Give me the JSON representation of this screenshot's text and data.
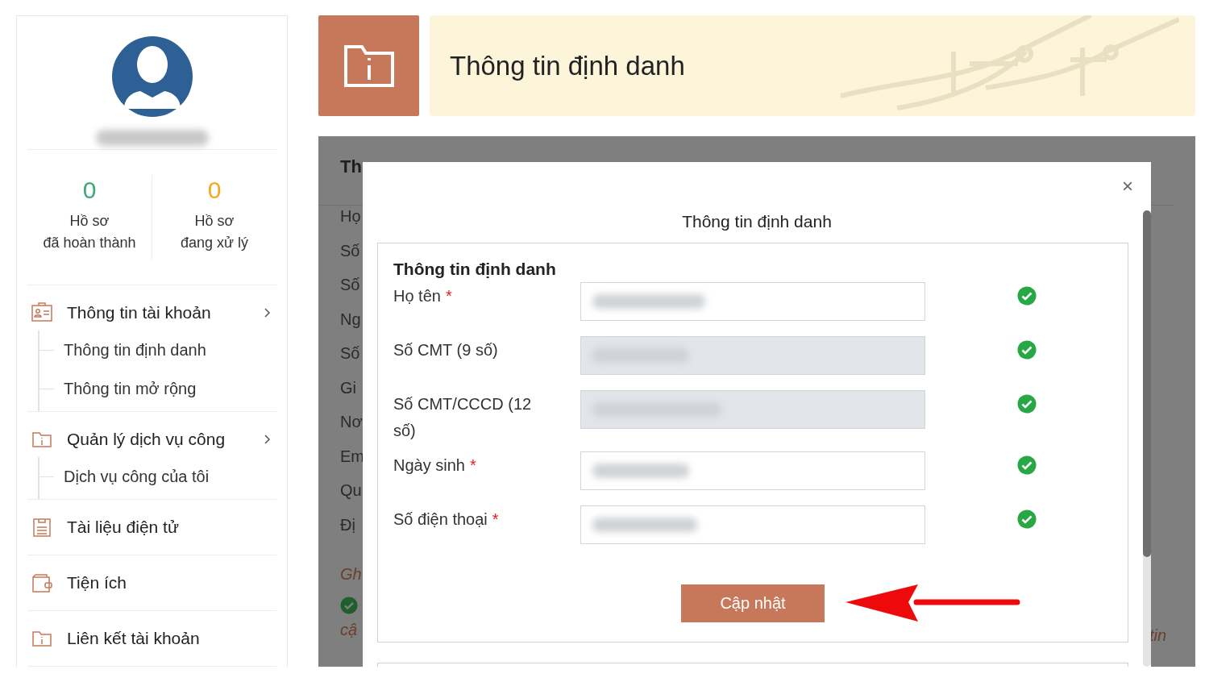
{
  "sidebar": {
    "stats": [
      {
        "value": "0",
        "label": "Hồ sơ\nđã hoàn thành",
        "color": "#3aaa78"
      },
      {
        "value": "0",
        "label": "Hồ sơ\nđang xử lý",
        "color": "#f5a623"
      }
    ],
    "menu": [
      {
        "label": "Thông tin tài khoản",
        "kind": "id-card",
        "expandable": true,
        "children": [
          {
            "label": "Thông tin định danh"
          },
          {
            "label": "Thông tin mở rộng"
          }
        ]
      },
      {
        "label": "Quản lý dịch vụ công",
        "kind": "folder",
        "expandable": true,
        "children": [
          {
            "label": "Dịch vụ công của tôi"
          }
        ]
      },
      {
        "label": "Tài liệu điện tử",
        "kind": "document",
        "expandable": false
      },
      {
        "label": "Tiện ích",
        "kind": "wallet",
        "expandable": false
      },
      {
        "label": "Liên kết tài khoản",
        "kind": "folder",
        "expandable": false
      }
    ]
  },
  "header": {
    "title": "Thông tin định danh"
  },
  "background_panel": {
    "heading": "Th",
    "rows": [
      "Họ",
      "Số",
      "Số",
      "Ng",
      "Số",
      "Gi",
      "Nơ",
      "Em",
      "Qu",
      "Đị"
    ],
    "note": "Gh",
    "note_end": "cậ",
    "right_fragment": "tin"
  },
  "modal": {
    "title": "Thông tin định danh",
    "close": "×",
    "section_title": "Thông tin định danh",
    "required_marker": "*",
    "fields": [
      {
        "label": "Họ tên",
        "required": true,
        "disabled": false,
        "valid": true
      },
      {
        "label": "Số CMT (9 số)",
        "required": false,
        "disabled": true,
        "valid": true
      },
      {
        "label": "Số CMT/CCCD (12 số)",
        "required": false,
        "disabled": true,
        "valid": true
      },
      {
        "label": "Ngày sinh",
        "required": true,
        "disabled": false,
        "valid": true
      },
      {
        "label": "Số điện thoại",
        "required": true,
        "disabled": false,
        "valid": true
      }
    ],
    "submit": "Cập nhật"
  }
}
